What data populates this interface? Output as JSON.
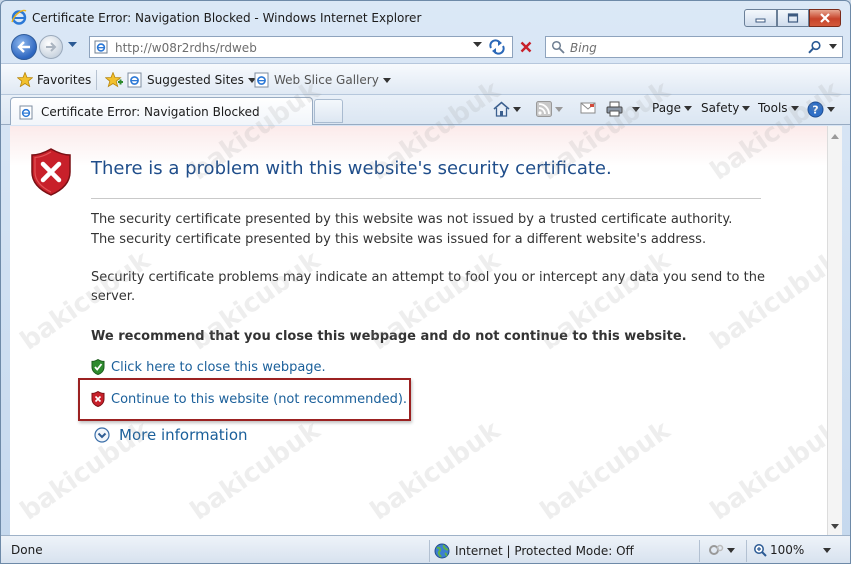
{
  "window": {
    "title": "Certificate Error: Navigation Blocked - Windows Internet Explorer"
  },
  "address_bar": {
    "url": "http://w08r2rdhs/rdweb",
    "search_placeholder": "Bing"
  },
  "favorites_bar": {
    "favorites_label": "Favorites",
    "suggested_sites_label": "Suggested Sites",
    "web_slice_gallery_label": "Web Slice Gallery"
  },
  "tabs": [
    {
      "label": "Certificate Error: Navigation Blocked"
    }
  ],
  "command_bar": {
    "page_label": "Page",
    "safety_label": "Safety",
    "tools_label": "Tools"
  },
  "content": {
    "heading": "There is a problem with this website's security certificate.",
    "line1": "The security certificate presented by this website was not issued by a trusted certificate authority.",
    "line2": "The security certificate presented by this website was issued for a different website's address.",
    "line3a": "Security certificate problems may indicate an attempt to fool you or intercept any data you send to the",
    "line3b": "server.",
    "recommendation": "We recommend that you close this webpage and do not continue to this website.",
    "close_link": "Click here to close this webpage.",
    "continue_link": "Continue to this website (not recommended).",
    "more_info": "More information"
  },
  "watermark": "bakicubuk",
  "status_bar": {
    "status": "Done",
    "zone": "Internet | Protected Mode: Off",
    "zoom": "100%"
  },
  "colors": {
    "heading": "#1f4d8a",
    "link": "#1a5f9a",
    "highlight_border": "#9b2121",
    "shield_red": "#c8202a",
    "shield_green": "#2e8b2e"
  }
}
